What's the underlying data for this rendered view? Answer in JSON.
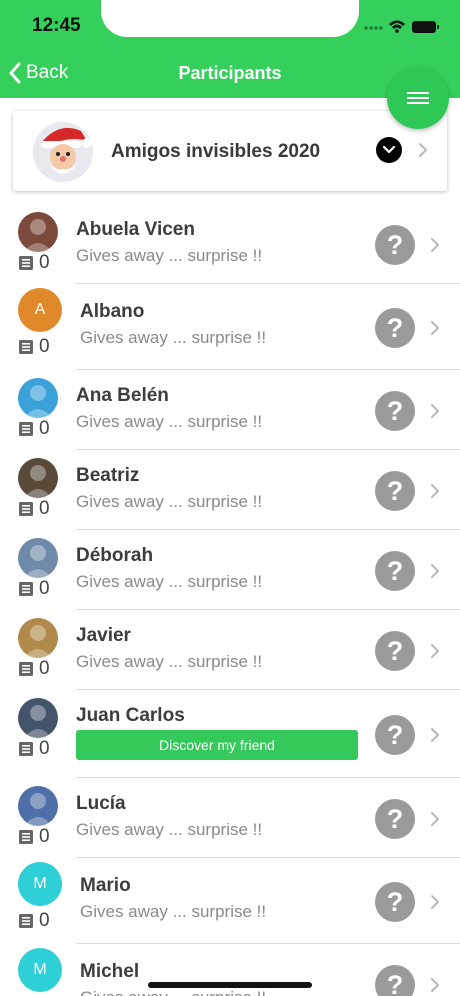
{
  "status_bar": {
    "time": "12:45"
  },
  "nav": {
    "back_label": "Back",
    "title": "Participants"
  },
  "group": {
    "name": "Amigos invisibles 2020"
  },
  "participants": [
    {
      "name": "Abuela Vicen",
      "subtitle": "Gives away ... surprise !!",
      "count": "0",
      "avatar": "photo",
      "color": "#7b4a3a"
    },
    {
      "name": "Albano",
      "subtitle": "Gives away ... surprise !!",
      "count": "0",
      "avatar": "letter",
      "initial": "A",
      "color": "#e0892b"
    },
    {
      "name": "Ana Belén",
      "subtitle": "Gives away ... surprise !!",
      "count": "0",
      "avatar": "photo",
      "color": "#3aa2d8"
    },
    {
      "name": "Beatriz",
      "subtitle": "Gives away ... surprise !!",
      "count": "0",
      "avatar": "photo",
      "color": "#5a4a3a"
    },
    {
      "name": "Déborah",
      "subtitle": "Gives away ... surprise !!",
      "count": "0",
      "avatar": "photo",
      "color": "#6f8aa8"
    },
    {
      "name": "Javier",
      "subtitle": "Gives away ... surprise !!",
      "count": "0",
      "avatar": "photo",
      "color": "#b08a4a"
    },
    {
      "name": "Juan Carlos",
      "subtitle": "",
      "count": "0",
      "avatar": "photo",
      "color": "#44546a",
      "action": "Discover my friend"
    },
    {
      "name": "Lucía",
      "subtitle": "Gives away ... surprise !!",
      "count": "0",
      "avatar": "photo",
      "color": "#4f6fa8"
    },
    {
      "name": "Mario",
      "subtitle": "Gives away ... surprise !!",
      "count": "0",
      "avatar": "letter",
      "initial": "M",
      "color": "#2fcfd8"
    },
    {
      "name": "Michel",
      "subtitle": "Gives away ... surprise !!",
      "count": "0",
      "avatar": "letter",
      "initial": "M",
      "color": "#2fcfd8"
    }
  ],
  "colors": {
    "brand": "#35cf5c",
    "fab": "#2ec857",
    "question": "#9a9a9a"
  }
}
